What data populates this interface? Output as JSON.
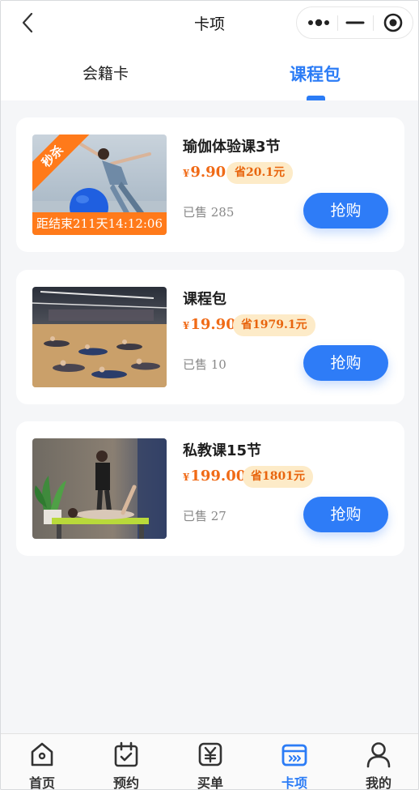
{
  "header": {
    "title": "卡项",
    "back_icon": "chevron-left-icon",
    "capsule_icons": [
      "more-dots-icon",
      "minimize-icon",
      "target-icon"
    ]
  },
  "tabs": [
    {
      "label": "会籍卡",
      "active": false
    },
    {
      "label": "课程包",
      "active": true
    }
  ],
  "colors": {
    "accent": "#2b7cf6",
    "price": "#f06a16",
    "seckill": "#ff7a1a",
    "save_tag_bg": "#fdebc8"
  },
  "cards": [
    {
      "title": "瑜伽体验课3节",
      "currency": "¥",
      "price": "9.90",
      "save": "省20.1元",
      "sold": "已售 285",
      "button": "抢购",
      "seckill": "秒杀",
      "countdown": "距结束211天14:12:06"
    },
    {
      "title": "课程包",
      "currency": "¥",
      "price": "19.90",
      "save": "省1979.1元",
      "sold": "已售 10",
      "button": "抢购"
    },
    {
      "title": "私教课15节",
      "currency": "¥",
      "price": "199.00",
      "save": "省1801元",
      "sold": "已售 27",
      "button": "抢购"
    }
  ],
  "bottom_nav": [
    {
      "label": "首页",
      "icon": "home-icon",
      "active": false
    },
    {
      "label": "预约",
      "icon": "calendar-check-icon",
      "active": false
    },
    {
      "label": "买单",
      "icon": "yen-receipt-icon",
      "active": false
    },
    {
      "label": "卡项",
      "icon": "card-icon",
      "active": true
    },
    {
      "label": "我的",
      "icon": "user-icon",
      "active": false
    }
  ]
}
